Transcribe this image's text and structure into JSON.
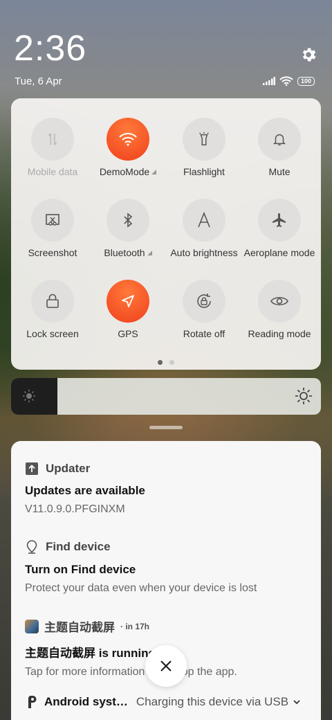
{
  "status_bar": {
    "time": "2:36",
    "date": "Tue, 6 Apr",
    "battery": "100"
  },
  "quick_settings": {
    "tiles": [
      {
        "label": "Mobile data",
        "icon": "mobile-data-icon",
        "active": false,
        "disabled": true
      },
      {
        "label": "DemoMode",
        "icon": "wifi-icon",
        "active": true,
        "expandable": true
      },
      {
        "label": "Flashlight",
        "icon": "flashlight-icon",
        "active": false
      },
      {
        "label": "Mute",
        "icon": "bell-icon",
        "active": false
      },
      {
        "label": "Screenshot",
        "icon": "screenshot-icon",
        "active": false
      },
      {
        "label": "Bluetooth",
        "icon": "bluetooth-icon",
        "active": false,
        "expandable": true
      },
      {
        "label": "Auto brightness",
        "icon": "auto-brightness-icon",
        "active": false
      },
      {
        "label": "Aeroplane mode",
        "icon": "airplane-icon",
        "active": false
      },
      {
        "label": "Lock screen",
        "icon": "lock-icon",
        "active": false
      },
      {
        "label": "GPS",
        "icon": "gps-icon",
        "active": true
      },
      {
        "label": "Rotate off",
        "icon": "rotate-lock-icon",
        "active": false
      },
      {
        "label": "Reading mode",
        "icon": "eye-icon",
        "active": false
      }
    ],
    "page_count": 2,
    "current_page": 1
  },
  "brightness": {
    "level": 0.15
  },
  "notifications": [
    {
      "app": "Updater",
      "title": "Updates are available",
      "text": "V11.0.9.0.PFGINXM",
      "icon": "upload-icon"
    },
    {
      "app": "Find device",
      "title": "Turn on Find device",
      "text": "Protect your data even when your device is lost",
      "icon": "location-pin-icon"
    },
    {
      "app": "主题自动截屏",
      "time": "· in 17h",
      "title": "主题自动截屏 is running",
      "text": "Tap for more information or to stop the app.",
      "icon": "app-icon"
    }
  ],
  "android_system": {
    "app": "Android syst…",
    "text": "Charging this device via USB"
  },
  "colors": {
    "accent": "#f05a24",
    "panel": "#f6f4f2"
  }
}
